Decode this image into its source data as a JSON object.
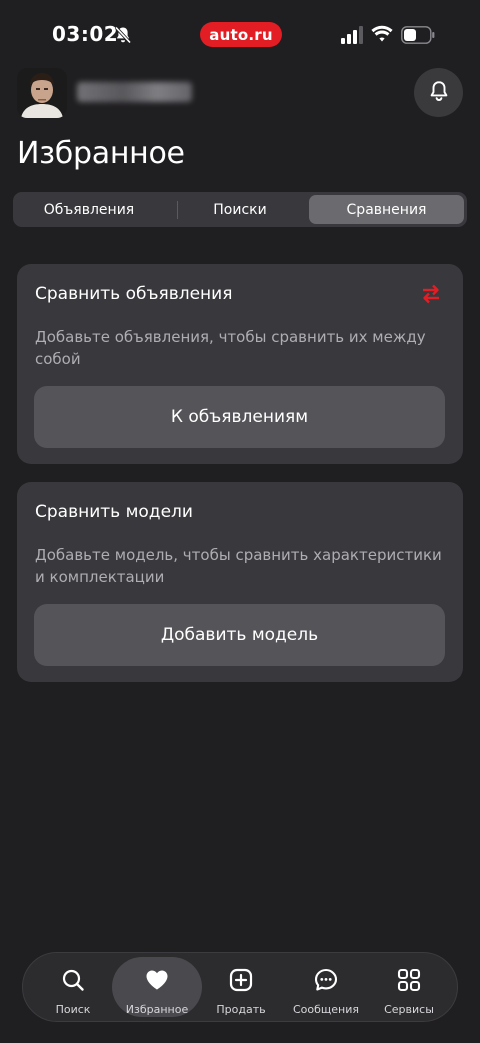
{
  "status_bar": {
    "time": "03:02",
    "brand": "auto.ru",
    "icons": [
      "bell-off-icon",
      "cellular-signal-icon",
      "wifi-icon",
      "battery-icon"
    ]
  },
  "header": {
    "avatar": "avatar",
    "user_name": "",
    "notification_icon": "bell-icon"
  },
  "page": {
    "title": "Избранное"
  },
  "segmented": {
    "tabs": [
      {
        "label": "Объявления",
        "selected": false
      },
      {
        "label": "Поиски",
        "selected": false
      },
      {
        "label": "Сравнения",
        "selected": true
      }
    ]
  },
  "cards": [
    {
      "title": "Сравнить объявления",
      "icon": "swap-arrows-icon",
      "description": "Добавьте объявления, чтобы сравнить их между собой",
      "button_label": "К объявлениям"
    },
    {
      "title": "Сравнить модели",
      "description": "Добавьте модель, чтобы сравнить характеристики и комплектации",
      "button_label": "Добавить модель"
    }
  ],
  "tabbar": {
    "items": [
      {
        "label": "Поиск",
        "icon": "search-icon",
        "active": false
      },
      {
        "label": "Избранное",
        "icon": "heart-icon",
        "active": true
      },
      {
        "label": "Продать",
        "icon": "plus-square-icon",
        "active": false
      },
      {
        "label": "Сообщения",
        "icon": "chat-bubble-icon",
        "active": false
      },
      {
        "label": "Сервисы",
        "icon": "grid-icon",
        "active": false
      }
    ]
  },
  "colors": {
    "background": "#1f1e21",
    "card": "#39383c",
    "button": "#555458",
    "accent_red": "#e31d24",
    "secondary_text": "#aeadb2"
  }
}
